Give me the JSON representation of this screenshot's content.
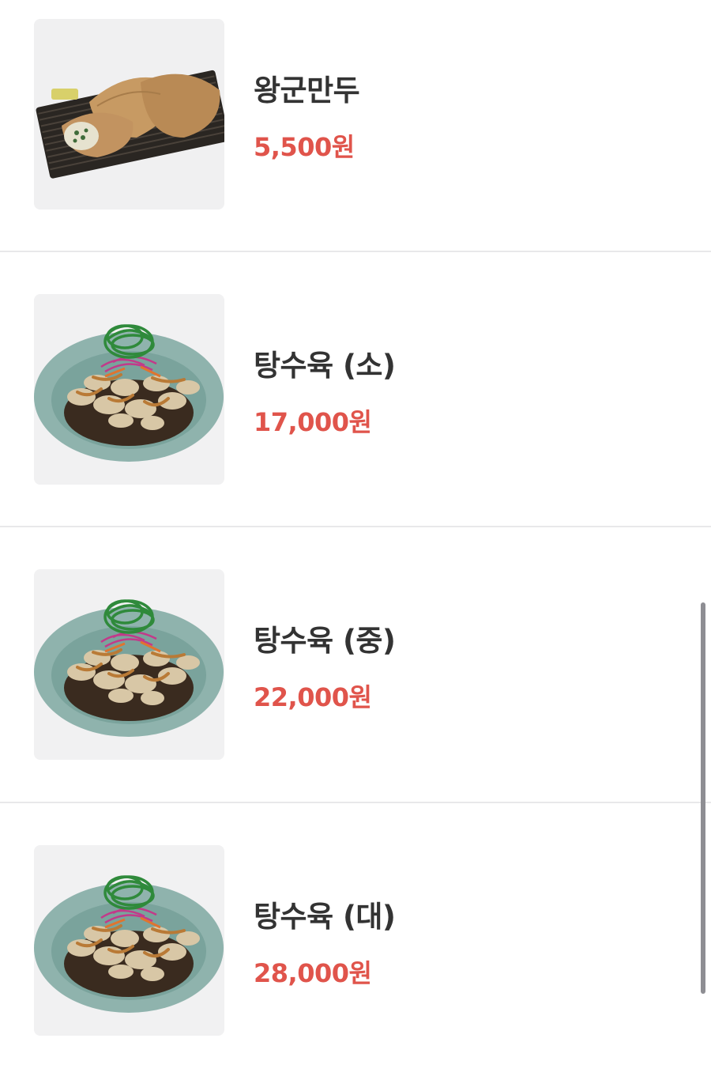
{
  "menu": {
    "items": [
      {
        "name": "왕군만두",
        "price": "5,500원",
        "image_icon": "dumpling-plate-image"
      },
      {
        "name": "탕수육 (소)",
        "price": "17,000원",
        "image_icon": "sweet-sour-pork-image"
      },
      {
        "name": "탕수육 (중)",
        "price": "22,000원",
        "image_icon": "sweet-sour-pork-image"
      },
      {
        "name": "탕수육 (대)",
        "price": "28,000원",
        "image_icon": "sweet-sour-pork-image"
      }
    ]
  },
  "colors": {
    "price": "#e0544b",
    "name": "#333333",
    "divider": "#e8e8ea",
    "background": "#ffffff",
    "thumb_background": "#f1f1f2",
    "plate_teal": "#8fb3ad"
  }
}
